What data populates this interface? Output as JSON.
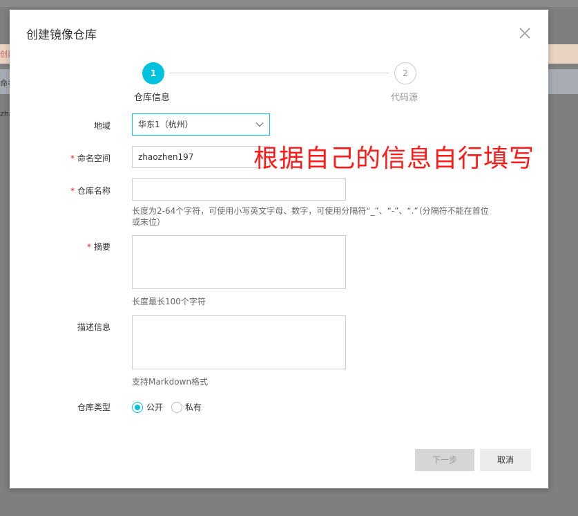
{
  "background": {
    "fragment_1": "创建",
    "fragment_2": "命名",
    "fragment_3": "zha"
  },
  "dialog": {
    "title": "创建镜像仓库",
    "steps": [
      {
        "number": "1",
        "label": "仓库信息",
        "state": "active"
      },
      {
        "number": "2",
        "label": "代码源",
        "state": "pending"
      }
    ]
  },
  "form": {
    "region": {
      "label": "地域",
      "value": "华东1（杭州）"
    },
    "namespace": {
      "label": "命名空间",
      "value": "zhaozhen197",
      "required": "*"
    },
    "repo_name": {
      "label": "仓库名称",
      "value": "",
      "required": "*",
      "hint_line1": "长度为2-64个字符，可使用小写英文字母、数字，可使用分隔符“_”、“-”、“.”（分隔符不能在首位",
      "hint_line2": "或末位）"
    },
    "summary": {
      "label": "摘要",
      "value": "",
      "required": "*",
      "hint": "长度最长100个字符"
    },
    "description": {
      "label": "描述信息",
      "value": "",
      "hint": "支持Markdown格式"
    },
    "repo_type": {
      "label": "仓库类型",
      "options": [
        "公开",
        "私有"
      ],
      "selected": "公开"
    }
  },
  "annotation": "根据自己的信息自行填写",
  "buttons": {
    "next": "下一步",
    "cancel": "取消"
  },
  "colors": {
    "accent": "#00c1de",
    "required": "#e72525",
    "annotation": "#ff1a1a"
  }
}
